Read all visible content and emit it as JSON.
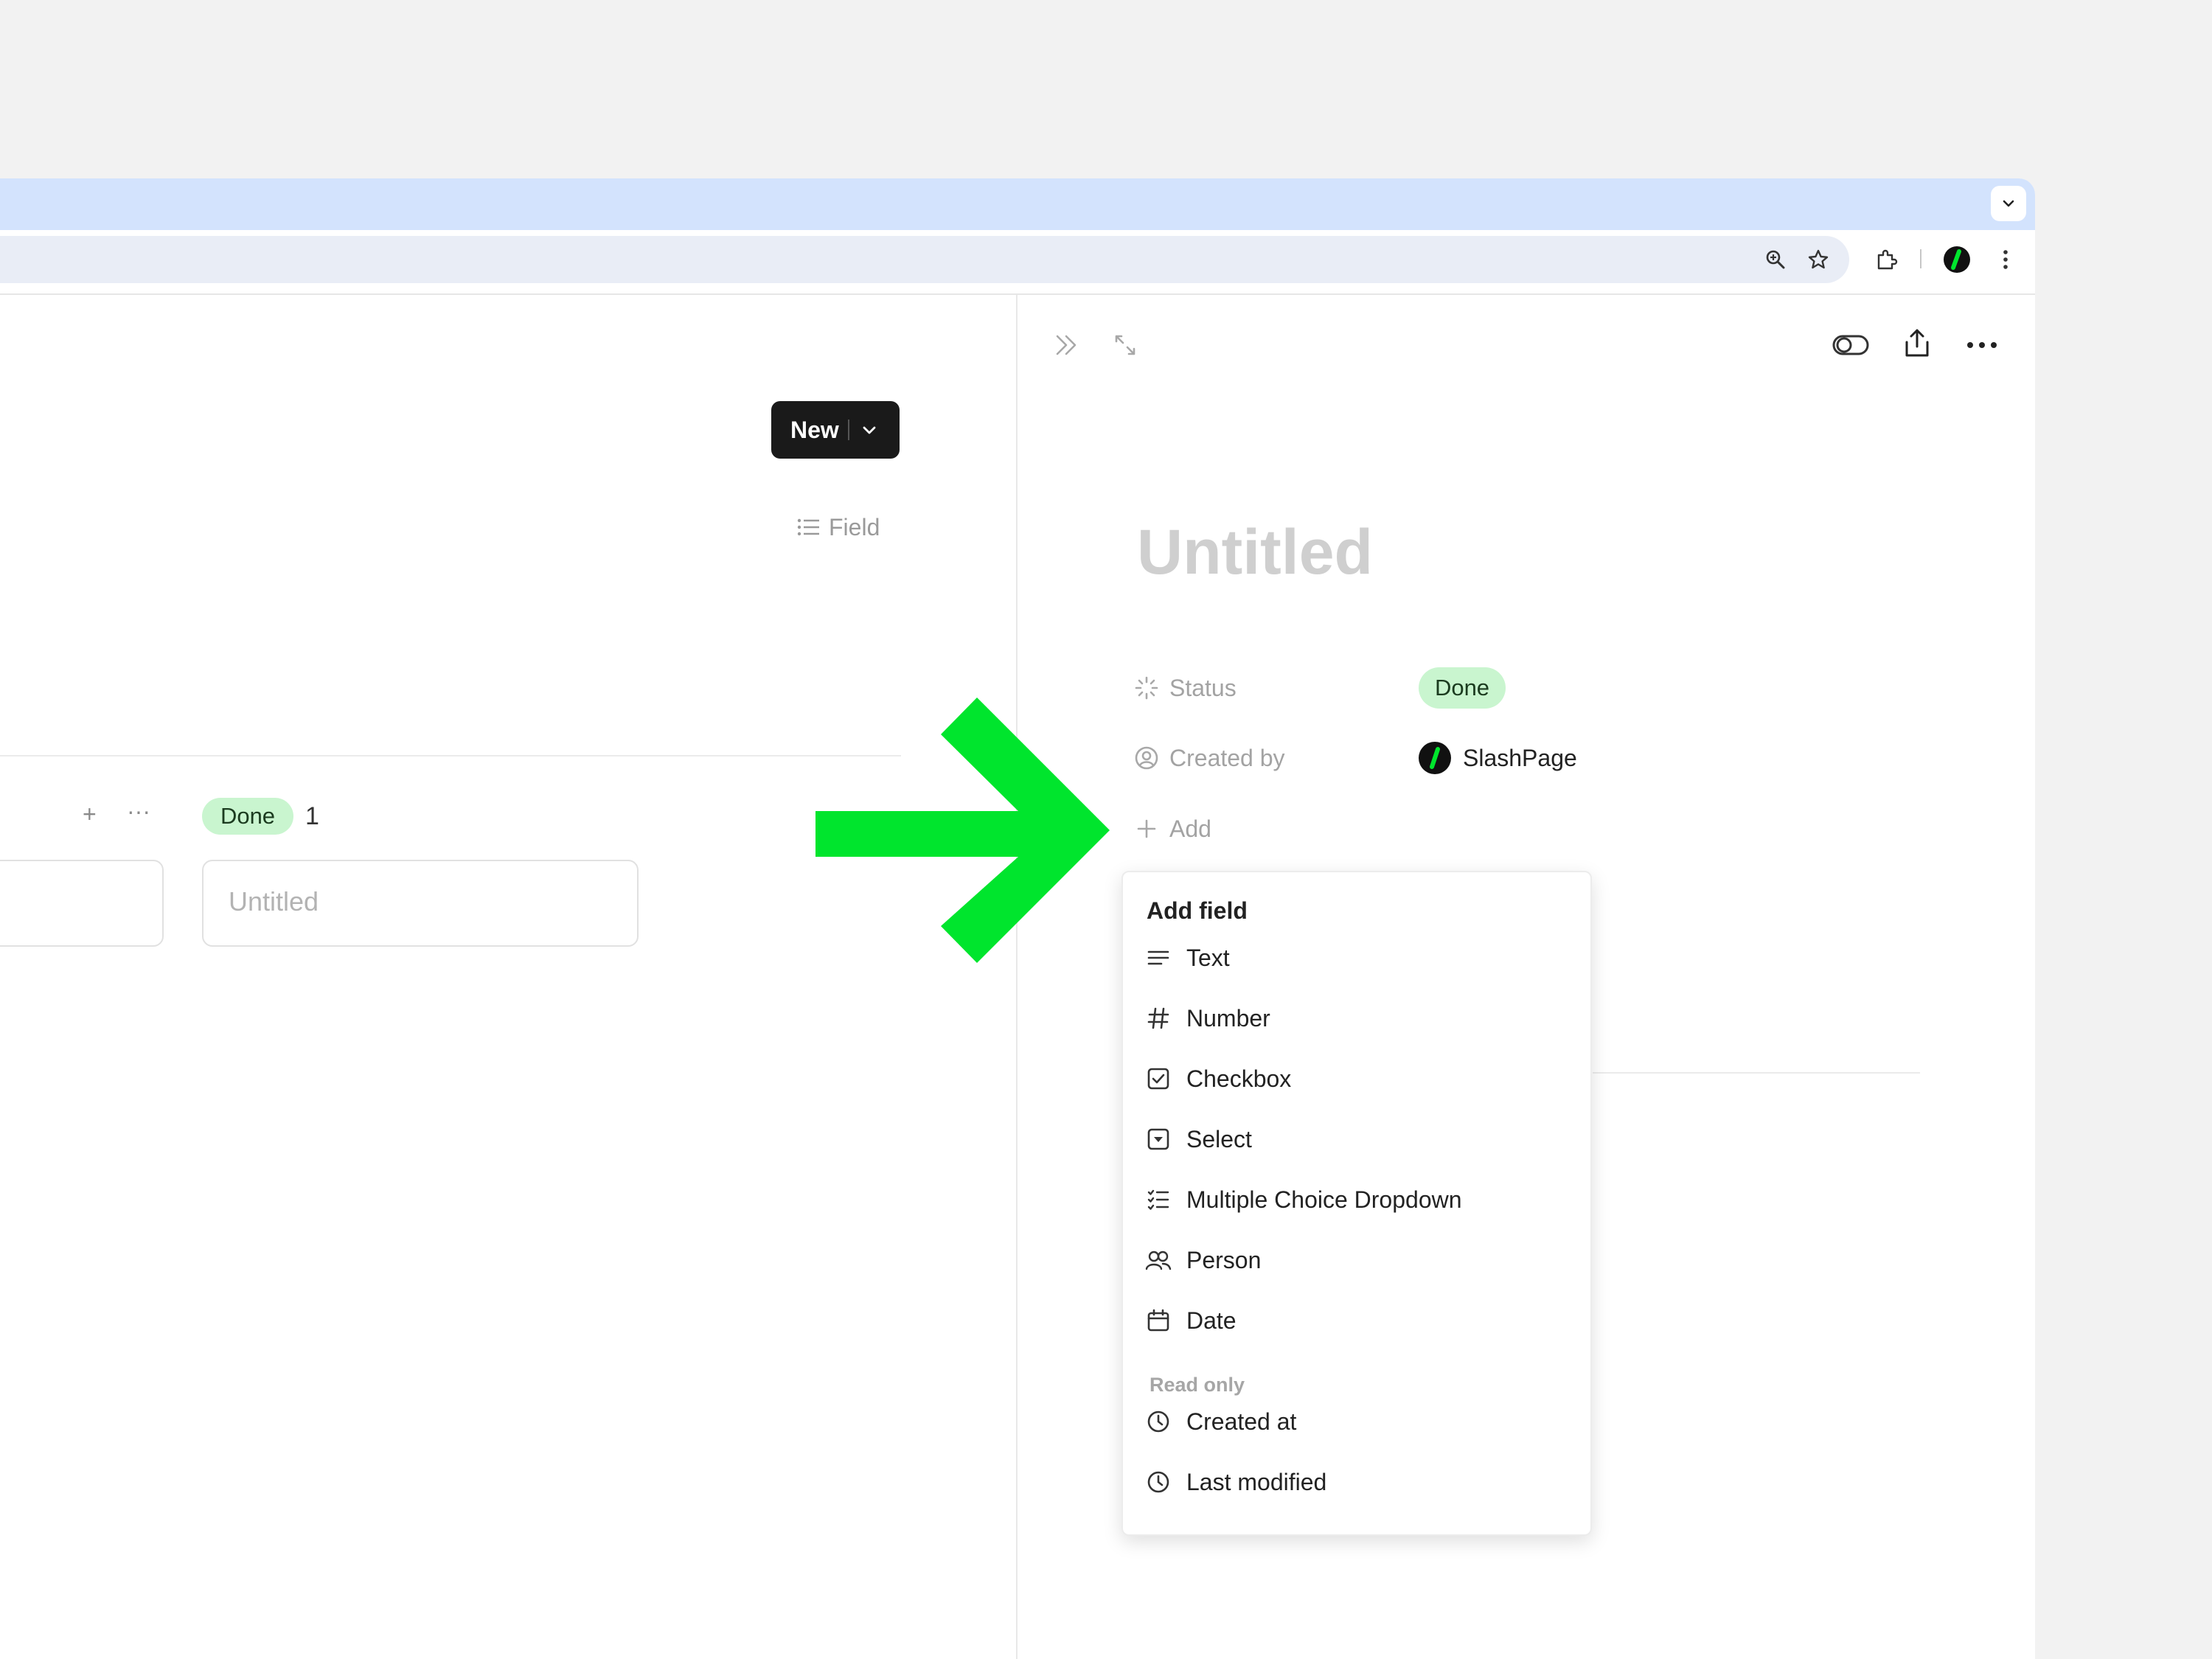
{
  "board": {
    "new_button": "New",
    "field_button": "Field",
    "column": {
      "add_symbol": "+",
      "more_symbol": "···",
      "status_label": "Done",
      "count": "1"
    },
    "card_title": "Untitled"
  },
  "detail": {
    "title": "Untitled",
    "properties": [
      {
        "label": "Status",
        "value": "Done"
      },
      {
        "label": "Created by",
        "value": "SlashPage"
      }
    ],
    "add_label": "Add"
  },
  "add_field_menu": {
    "title": "Add field",
    "items": [
      {
        "label": "Text",
        "icon": "text-lines-icon"
      },
      {
        "label": "Number",
        "icon": "hash-icon"
      },
      {
        "label": "Checkbox",
        "icon": "checkbox-icon"
      },
      {
        "label": "Select",
        "icon": "select-icon"
      },
      {
        "label": "Multiple Choice Dropdown",
        "icon": "checklist-icon"
      },
      {
        "label": "Person",
        "icon": "people-icon"
      },
      {
        "label": "Date",
        "icon": "calendar-icon"
      }
    ],
    "read_only_label": "Read only",
    "read_only_items": [
      {
        "label": "Created at",
        "icon": "clock-icon"
      },
      {
        "label": "Last modified",
        "icon": "clock-icon"
      }
    ]
  },
  "colors": {
    "annotation_arrow": "#00e52d",
    "done_badge_bg": "#c9f5cf",
    "tabstrip_bg": "#d3e3fd",
    "new_button_bg": "#1a1a1a"
  }
}
